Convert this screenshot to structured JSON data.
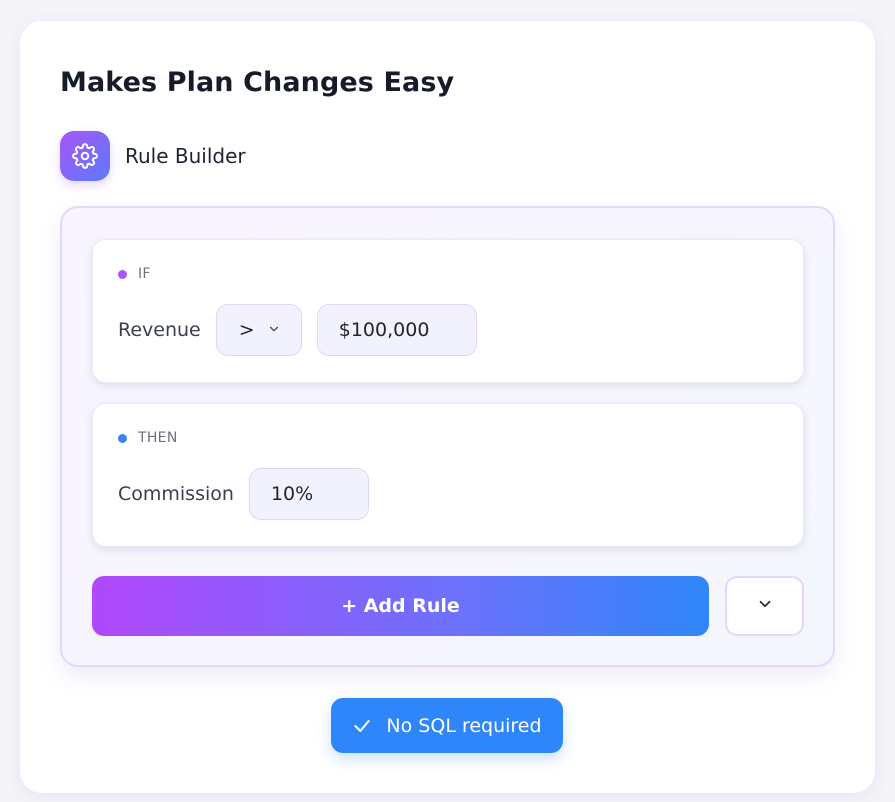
{
  "card": {
    "title": "Makes Plan Changes Easy"
  },
  "header": {
    "icon": "gear-icon",
    "label": "Rule Builder"
  },
  "rules": {
    "if": {
      "tag": "IF",
      "field_label": "Revenue",
      "operator": ">",
      "value": "$100,000"
    },
    "then": {
      "tag": "THEN",
      "field_label": "Commission",
      "value": "10%"
    }
  },
  "actions": {
    "add_rule_label": "+ Add Rule",
    "more_icon": "chevron-down-icon"
  },
  "badge": {
    "icon": "check-icon",
    "label": "No SQL required"
  },
  "colors": {
    "accent_purple": "#a855f7",
    "accent_blue": "#2f86fa"
  }
}
